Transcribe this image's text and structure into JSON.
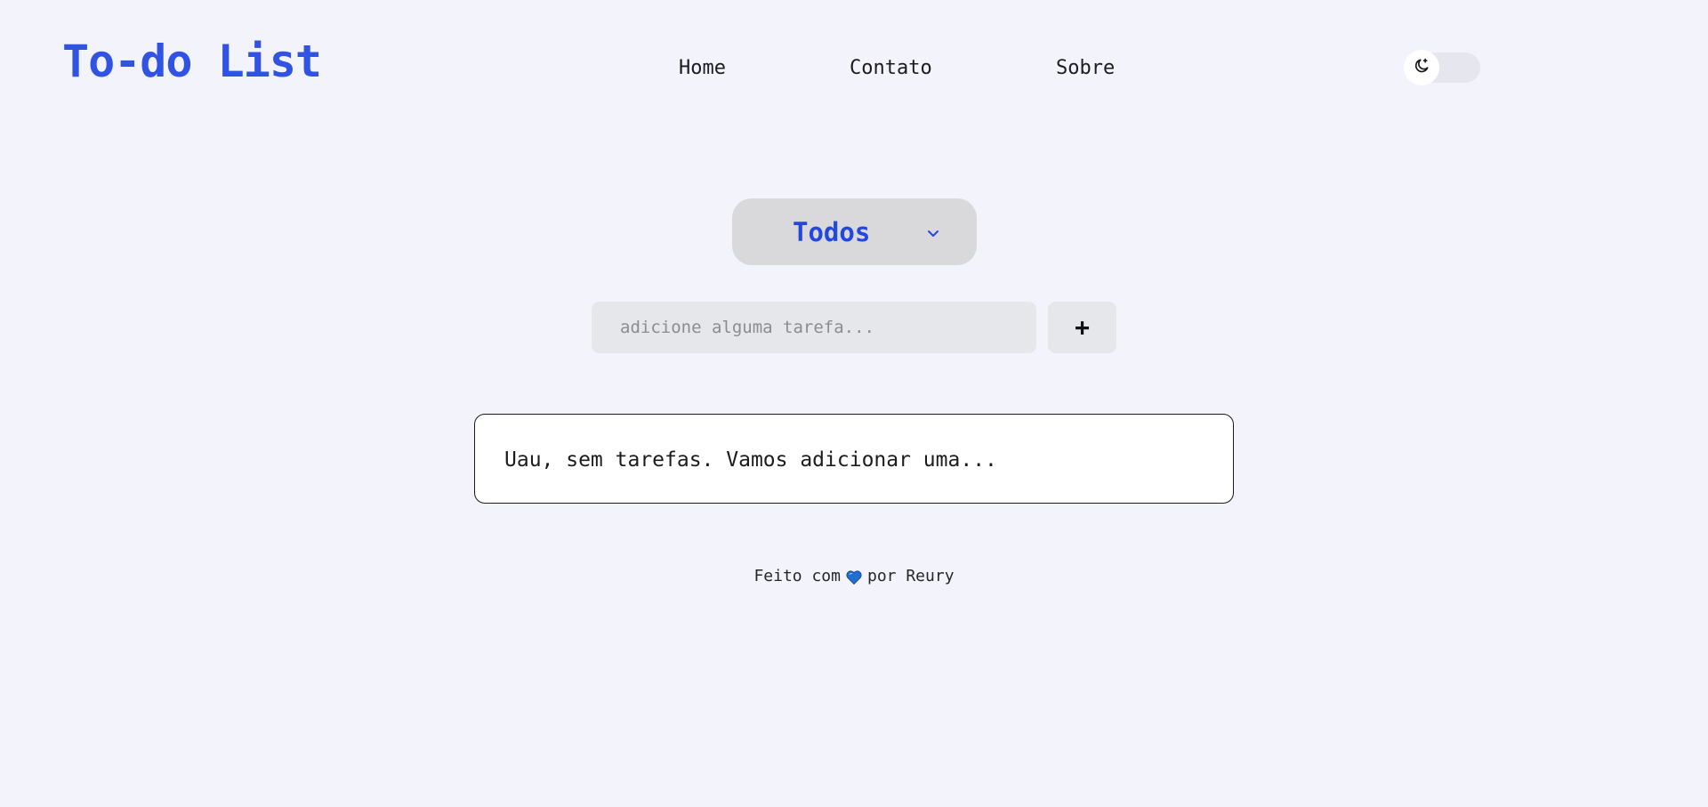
{
  "header": {
    "logo": "To-do List",
    "nav": [
      {
        "label": "Home"
      },
      {
        "label": "Contato"
      },
      {
        "label": "Sobre"
      }
    ],
    "theme_toggle": {
      "icon": "moon-icon",
      "state": "off"
    }
  },
  "filter": {
    "selected": "Todos",
    "icon": "chevron-down-icon",
    "accent_color": "#2447e0"
  },
  "add_task": {
    "placeholder": "adicione alguma tarefa...",
    "value": "",
    "button_label": "+"
  },
  "tasks": {
    "empty_message": "Uau, sem tarefas. Vamos adicionar uma..."
  },
  "footer": {
    "prefix": "Feito com",
    "icon": "heart-icon",
    "suffix": "por Reury"
  },
  "colors": {
    "background": "#f2f3fb",
    "brand": "#3153e3",
    "heart": "#1f6fd1"
  }
}
